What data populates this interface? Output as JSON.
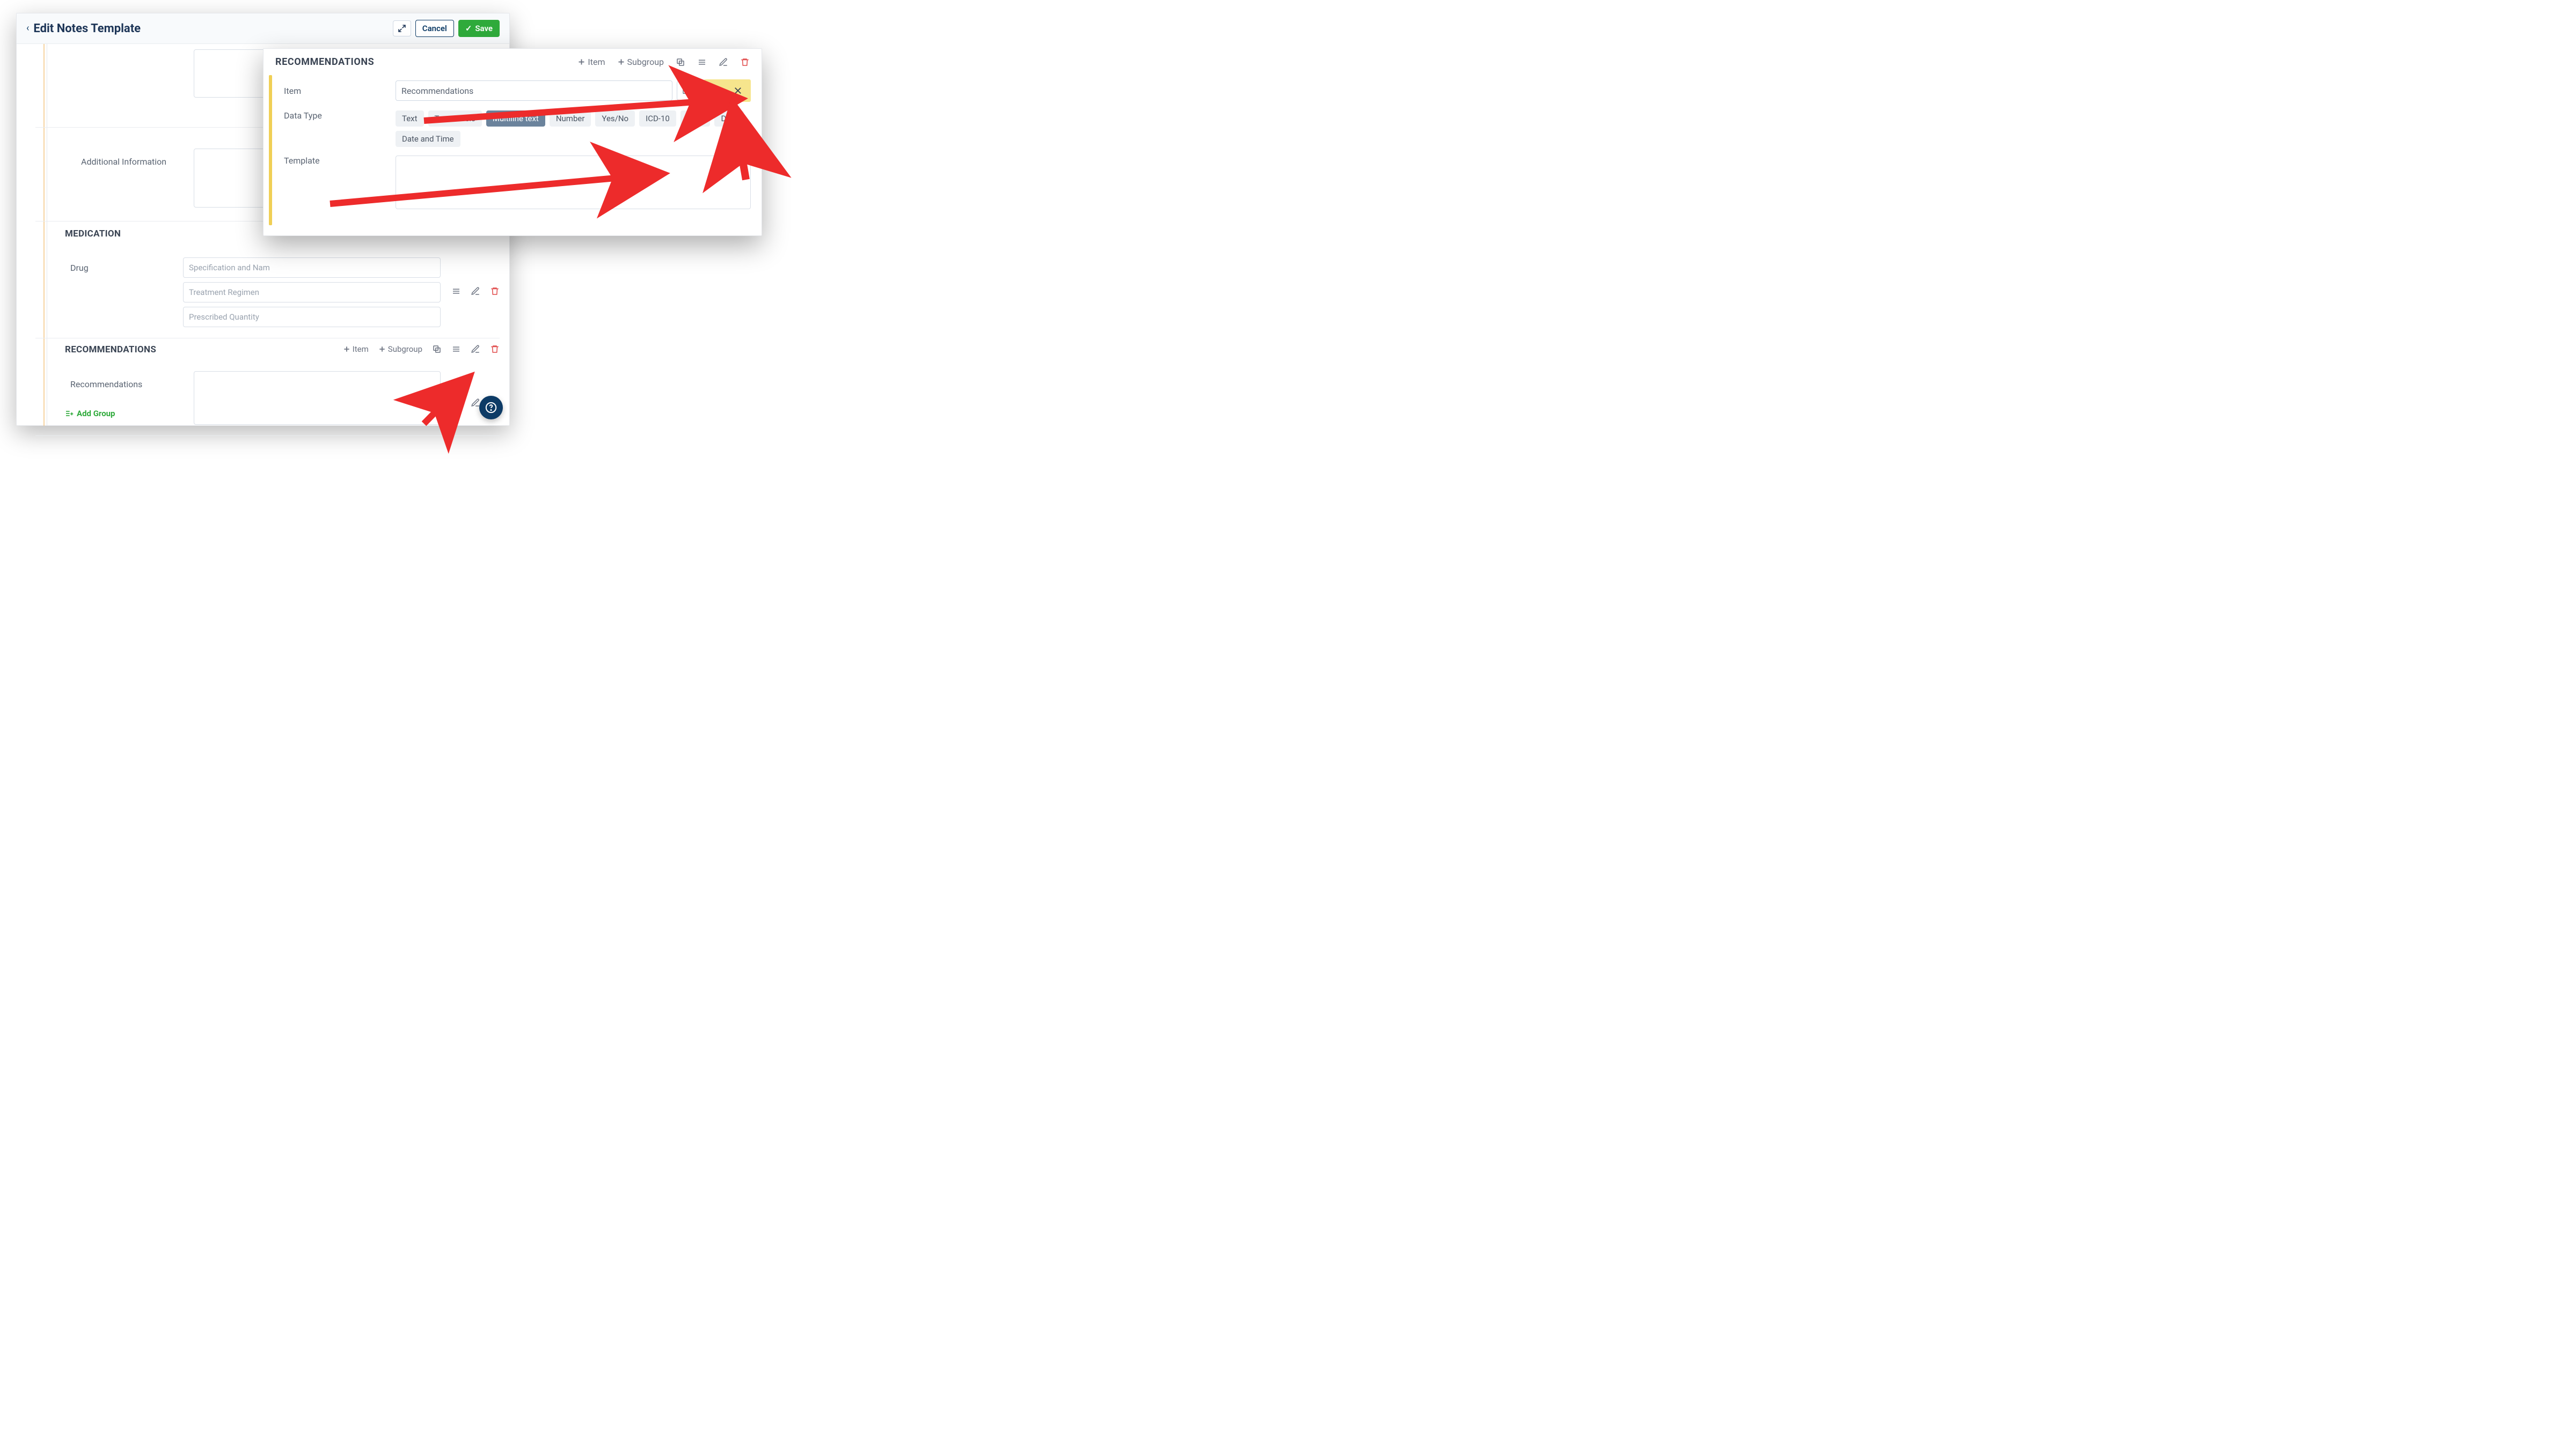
{
  "header": {
    "title": "Edit Notes Template",
    "cancel": "Cancel",
    "save": "Save"
  },
  "editor": {
    "additional_info_label": "Additional Information",
    "medication_title": "MEDICATION",
    "drug_label": "Drug",
    "drug_placeholders": {
      "spec": "Specification and Nam",
      "regimen": "Treatment Regimen",
      "qty": "Prescribed Quantity"
    },
    "recommend_title": "RECOMMENDATIONS",
    "recommend_item": "Item",
    "recommend_subgroup": "Subgroup",
    "recommend_field_label": "Recommendations",
    "add_group": "Add Group"
  },
  "panel": {
    "title": "RECOMMENDATIONS",
    "item_btn": "Item",
    "subgroup_btn": "Subgroup",
    "item_label": "Item",
    "item_value": "Recommendations",
    "datatype_label": "Data Type",
    "template_label": "Template",
    "types": {
      "text": "Text",
      "labels": "Text Labels",
      "multiline": "Multiline text",
      "number": "Number",
      "yesno": "Yes/No",
      "icd": "ICD-10",
      "drug": "Drug",
      "date": "Date",
      "datetime": "Date and Time"
    }
  }
}
